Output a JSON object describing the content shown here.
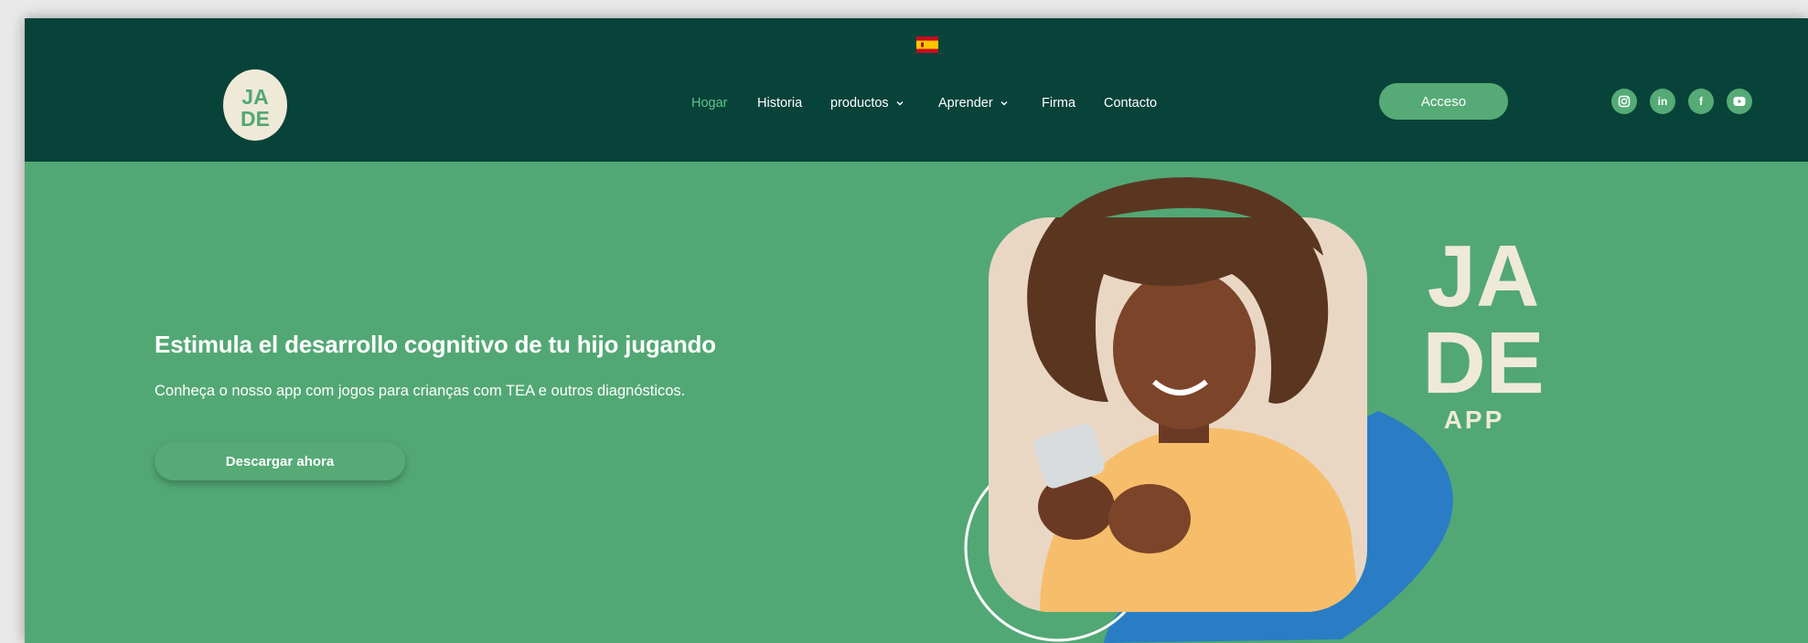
{
  "header": {
    "language": "es",
    "nav": [
      {
        "label": "Hogar",
        "active": true,
        "dropdown": false
      },
      {
        "label": "Historia",
        "active": false,
        "dropdown": false
      },
      {
        "label": "productos",
        "active": false,
        "dropdown": true
      },
      {
        "label": "Aprender",
        "active": false,
        "dropdown": true
      },
      {
        "label": "Firma",
        "active": false,
        "dropdown": false
      },
      {
        "label": "Contacto",
        "active": false,
        "dropdown": false
      }
    ],
    "login_label": "Acceso",
    "social": [
      {
        "icon": "instagram-icon",
        "glyph": "◎"
      },
      {
        "icon": "linkedin-icon",
        "glyph": "in"
      },
      {
        "icon": "facebook-icon",
        "glyph": "f"
      },
      {
        "icon": "youtube-icon",
        "glyph": "▶"
      }
    ]
  },
  "hero": {
    "title": "Estimula el desarrollo cognitivo de tu hijo jugando",
    "subtitle": "Conheça o nosso app com jogos para crianças com TEA e outros diagnósticos.",
    "download_label": "Descargar ahora",
    "brand_mark": "JA DE",
    "brand_sub": "APP"
  },
  "colors": {
    "header_bg": "#08433a",
    "hero_bg": "#52a874",
    "button": "#55aa76",
    "accent_active": "#5dc685",
    "blob": "#2a7dc5",
    "cream": "#efe9d8"
  }
}
